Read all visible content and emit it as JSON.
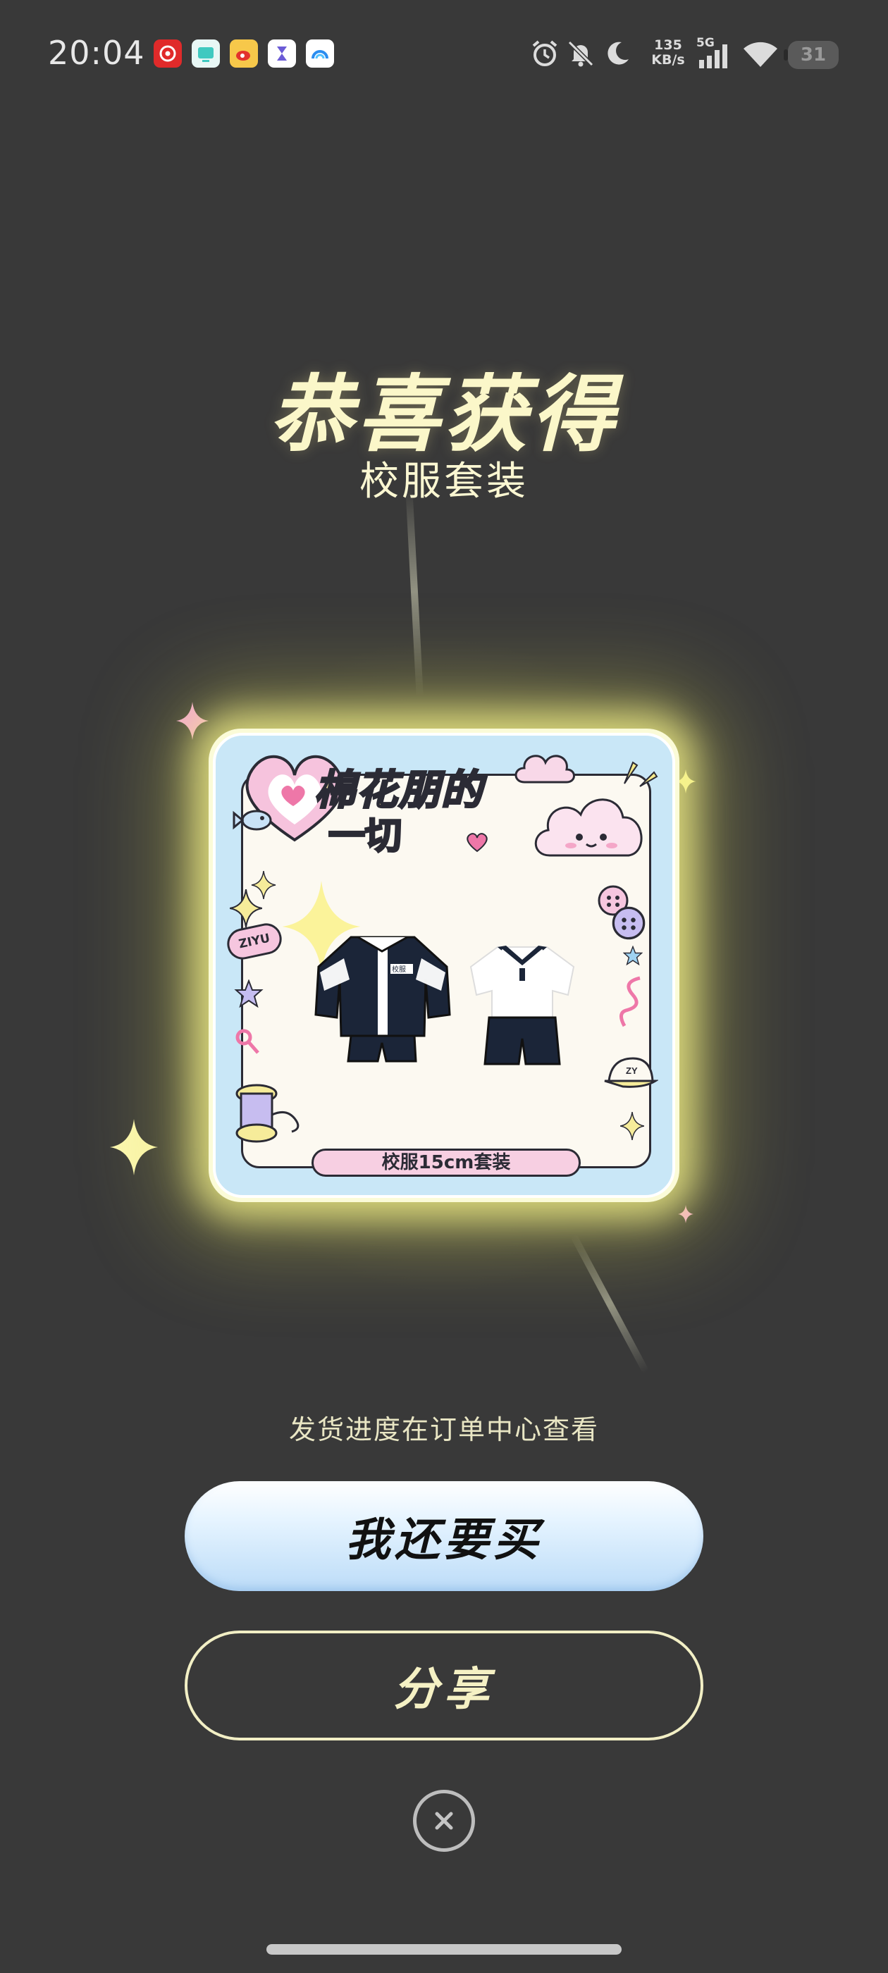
{
  "status_bar": {
    "time": "20:04",
    "network_speed_value": "135",
    "network_speed_unit": "KB/s",
    "signal_label": "5G",
    "battery_level": "31",
    "app_icons": [
      "netease-music-icon",
      "tv-app-icon",
      "weibo-icon",
      "hourglass-app-icon",
      "browser-app-icon"
    ]
  },
  "reward": {
    "title": "恭喜获得",
    "item_name": "校服套装"
  },
  "card": {
    "brand_line1": "棉花朋的",
    "brand_line2": "一切",
    "badge_text": "ZIYU",
    "cap_text": "ZY",
    "product_label": "校服15cm套装",
    "jacket_tag": "校服"
  },
  "hint_text": "发货进度在订单中心查看",
  "buttons": {
    "buy_again": "我还要买",
    "share": "分享"
  },
  "colors": {
    "background": "#393939",
    "title": "#fbf7c9",
    "card_glow": "#f8f68c",
    "primary_button": "#bcdcf8",
    "card_frame": "#c9e7f7"
  }
}
